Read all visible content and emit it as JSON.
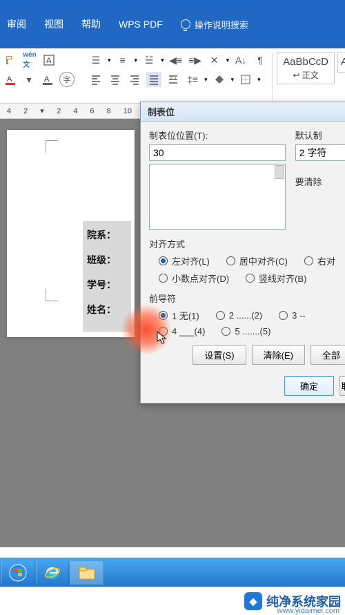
{
  "menu": {
    "review": "审阅",
    "view": "视图",
    "help": "帮助",
    "wpspdf": "WPS PDF",
    "search_hint": "操作说明搜索"
  },
  "ribbon": {
    "style_preview": "AaBbCcD",
    "style_name": "正文"
  },
  "ruler_marks": [
    "4",
    "2",
    "",
    "2",
    "4",
    "6",
    "8",
    "10"
  ],
  "dialog": {
    "title": "制表位",
    "pos_label": "制表位位置(T):",
    "pos_value": "30",
    "default_label": "默认制",
    "default_value": "2 字符",
    "clear_label": "要清除",
    "align_title": "对齐方式",
    "align": {
      "left": "左对齐(L)",
      "center": "居中对齐(C)",
      "right": "右对",
      "decimal": "小数点对齐(D)",
      "bar": "竖线对齐(B)"
    },
    "leader_title": "前导符",
    "leader": {
      "l1": "1 无(1)",
      "l2": "2 ......(2)",
      "l3": "3 --",
      "l4": "4 ___(4)",
      "l5": "5 .......(5)"
    },
    "btn_set": "设置(S)",
    "btn_clear": "清除(E)",
    "btn_clearall": "全部",
    "btn_ok": "确定",
    "btn_cancel": "取"
  },
  "form_fields": {
    "dept": "院系：",
    "class": "班级：",
    "id": "学号：",
    "name": "姓名："
  },
  "watermark": {
    "text": "纯净系统家园",
    "url": "www.yidaimei.com"
  }
}
